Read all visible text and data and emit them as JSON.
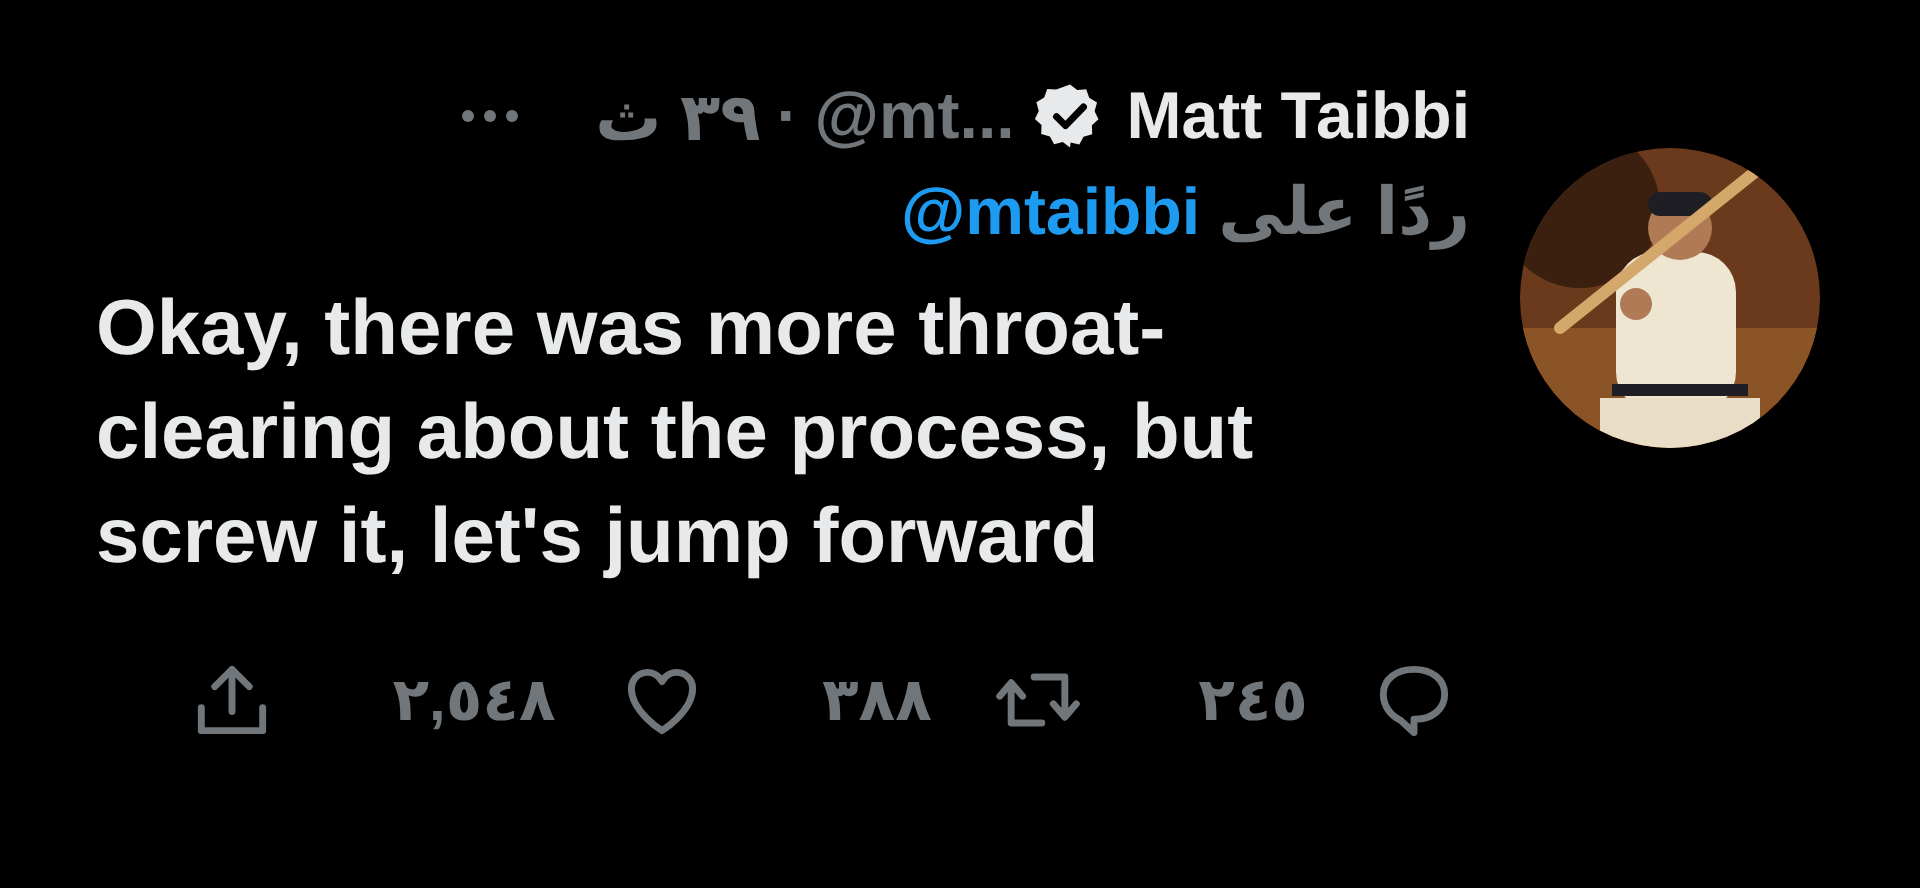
{
  "tweet": {
    "author": {
      "name": "Matt Taibbi",
      "verified": true,
      "handle": "@mt...",
      "separator": "·",
      "time": "٣٩ ث"
    },
    "reply_to": {
      "prefix": "ردًا على",
      "handle": "@mtaibbi"
    },
    "text": "Okay, there was more throat-clearing about the process, but screw it, let's jump forward",
    "actions": [
      {
        "kind": "reply",
        "count": "٢٤٥"
      },
      {
        "kind": "retweet",
        "count": "٣٨٨"
      },
      {
        "kind": "like",
        "count": "٢,٥٤٨"
      },
      {
        "kind": "share"
      }
    ]
  }
}
